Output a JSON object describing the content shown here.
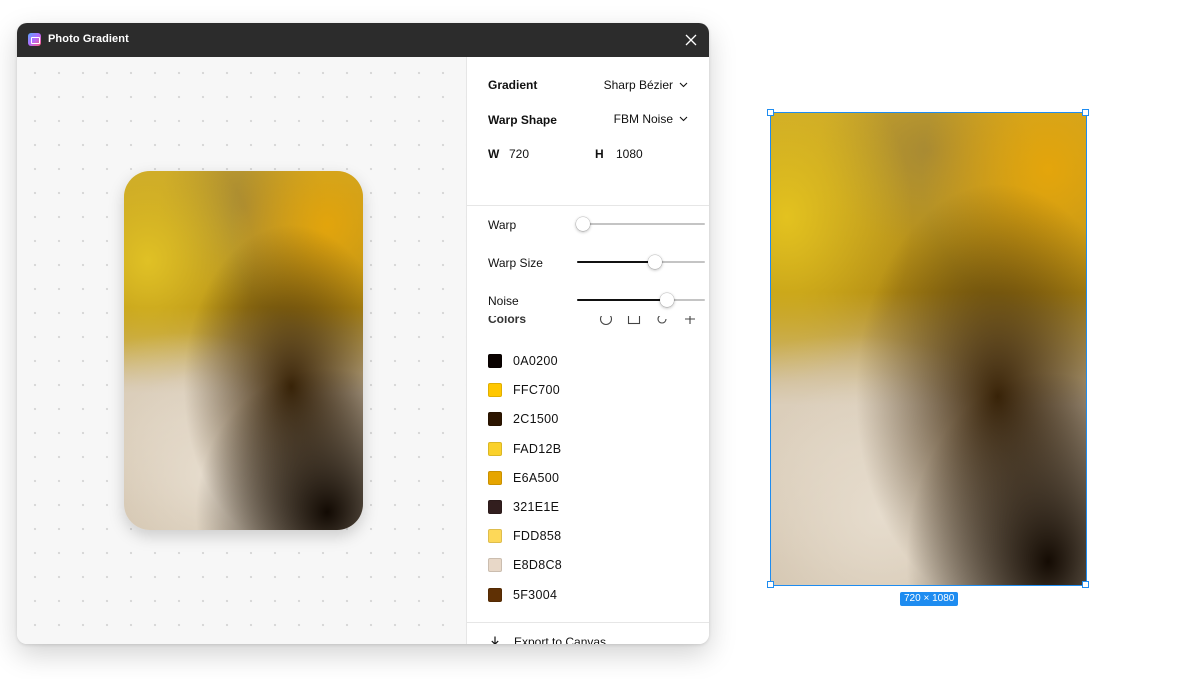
{
  "window": {
    "title": "Photo Gradient"
  },
  "panel": {
    "gradient": {
      "label": "Gradient",
      "value": "Sharp Bézier"
    },
    "warp_shape": {
      "label": "Warp Shape",
      "value": "FBM Noise"
    },
    "size": {
      "w_label": "W",
      "w_value": "720",
      "h_label": "H",
      "h_value": "1080"
    },
    "sliders": [
      {
        "label": "Warp",
        "value": 0.05
      },
      {
        "label": "Warp Size",
        "value": 0.61
      },
      {
        "label": "Noise",
        "value": 0.7
      }
    ],
    "colors_title": "Colors",
    "colors": [
      {
        "hex": "0A0200"
      },
      {
        "hex": "FFC700"
      },
      {
        "hex": "2C1500"
      },
      {
        "hex": "FAD12B"
      },
      {
        "hex": "E6A500"
      },
      {
        "hex": "321E1E"
      },
      {
        "hex": "FDD858"
      },
      {
        "hex": "E8D8C8"
      },
      {
        "hex": "5F3004"
      }
    ],
    "export_label": "Export to Canvas"
  },
  "canvas": {
    "size_badge": "720 × 1080"
  },
  "accent_color": "#1e8cf0"
}
